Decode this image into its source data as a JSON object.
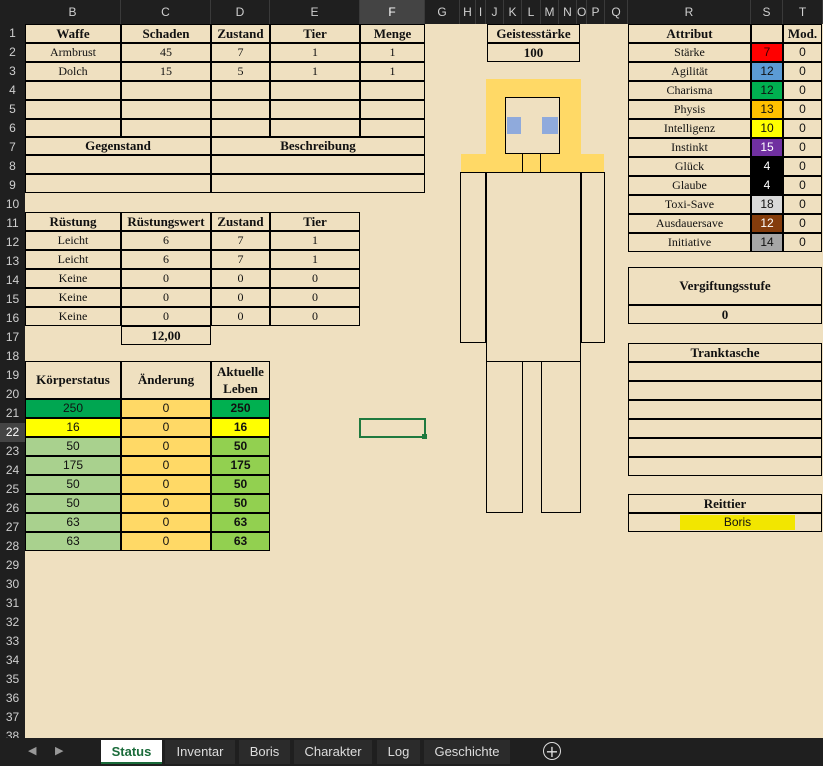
{
  "columns": [
    "B",
    "C",
    "D",
    "E",
    "F",
    "G",
    "H",
    "I",
    "J",
    "K",
    "L",
    "M",
    "N",
    "O",
    "P",
    "Q",
    "R",
    "S",
    "T"
  ],
  "rows": [
    "1",
    "2",
    "3",
    "4",
    "5",
    "6",
    "7",
    "8",
    "9",
    "10",
    "11",
    "12",
    "13",
    "14",
    "15",
    "16",
    "17",
    "18",
    "19",
    "20",
    "21",
    "22",
    "23",
    "24",
    "25",
    "26",
    "27",
    "28",
    "29",
    "30",
    "31",
    "32",
    "33",
    "34",
    "35",
    "36",
    "37",
    "38"
  ],
  "weapons": {
    "headers": [
      "Waffe",
      "Schaden",
      "Zustand",
      "Tier",
      "Menge"
    ],
    "rows": [
      [
        "Armbrust",
        "45",
        "7",
        "1",
        "1"
      ],
      [
        "Dolch",
        "15",
        "5",
        "1",
        "1"
      ]
    ]
  },
  "items": {
    "headers": [
      "Gegenstand",
      "Beschreibung"
    ]
  },
  "armor": {
    "headers": [
      "Rüstung",
      "Rüstungswert",
      "Zustand",
      "Tier"
    ],
    "rows": [
      [
        "Leicht",
        "6",
        "7",
        "1"
      ],
      [
        "Leicht",
        "6",
        "7",
        "1"
      ],
      [
        "Keine",
        "0",
        "0",
        "0"
      ],
      [
        "Keine",
        "0",
        "0",
        "0"
      ],
      [
        "Keine",
        "0",
        "0",
        "0"
      ]
    ],
    "total": "12,00"
  },
  "body_status": {
    "headers": [
      "Körperstatus",
      "Änderung",
      "Aktuelle Leben"
    ],
    "rows": [
      {
        "status": "250",
        "change": "0",
        "current": "250",
        "color": "#00a651",
        "current_color": "#00b050"
      },
      {
        "status": "16",
        "change": "0",
        "current": "16",
        "color": "#ffff00",
        "current_color": "#ffff00"
      },
      {
        "status": "50",
        "change": "0",
        "current": "50",
        "color": "#a9d18e",
        "current_color": "#92d050"
      },
      {
        "status": "175",
        "change": "0",
        "current": "175",
        "color": "#a9d18e",
        "current_color": "#92d050"
      },
      {
        "status": "50",
        "change": "0",
        "current": "50",
        "color": "#a9d18e",
        "current_color": "#92d050"
      },
      {
        "status": "50",
        "change": "0",
        "current": "50",
        "color": "#a9d18e",
        "current_color": "#92d050"
      },
      {
        "status": "63",
        "change": "0",
        "current": "63",
        "color": "#a9d18e",
        "current_color": "#92d050"
      },
      {
        "status": "63",
        "change": "0",
        "current": "63",
        "color": "#a9d18e",
        "current_color": "#92d050"
      }
    ],
    "change_color": "#ffd966"
  },
  "spirit": {
    "label": "Geistesstärke",
    "value": "100"
  },
  "attributes": {
    "headers": [
      "Attribut",
      "",
      "Mod."
    ],
    "rows": [
      {
        "name": "Stärke",
        "value": "7",
        "mod": "0",
        "color": "#ff0000"
      },
      {
        "name": "Agilität",
        "value": "12",
        "mod": "0",
        "color": "#5b9bd5"
      },
      {
        "name": "Charisma",
        "value": "12",
        "mod": "0",
        "color": "#00b050"
      },
      {
        "name": "Physis",
        "value": "13",
        "mod": "0",
        "color": "#ffc000"
      },
      {
        "name": "Intelligenz",
        "value": "10",
        "mod": "0",
        "color": "#ffff00"
      },
      {
        "name": "Instinkt",
        "value": "15",
        "mod": "0",
        "color": "#7030a0"
      },
      {
        "name": "Glück",
        "value": "4",
        "mod": "0",
        "color": "#000000"
      },
      {
        "name": "Glaube",
        "value": "4",
        "mod": "0",
        "color": "#000000"
      },
      {
        "name": "Toxi-Save",
        "value": "18",
        "mod": "0",
        "color": "#d9d9d9"
      },
      {
        "name": "Ausdauersave",
        "value": "12",
        "mod": "0",
        "color": "#843c0c"
      },
      {
        "name": "Initiative",
        "value": "14",
        "mod": "0",
        "color": "#a6a6a6"
      }
    ]
  },
  "poison": {
    "label": "Vergiftungsstufe",
    "value": "0"
  },
  "potion_bag": {
    "label": "Tranktasche"
  },
  "mount": {
    "label": "Reittier",
    "value": "Boris",
    "color": "#f2e600"
  },
  "tabs": [
    "Status",
    "Inventar",
    "Boris",
    "Charakter",
    "Log",
    "Geschichte"
  ],
  "active_tab": "Status",
  "icons": {
    "prev": "triangle-left-icon",
    "next": "triangle-right-icon",
    "add": "plus-circle-icon"
  }
}
